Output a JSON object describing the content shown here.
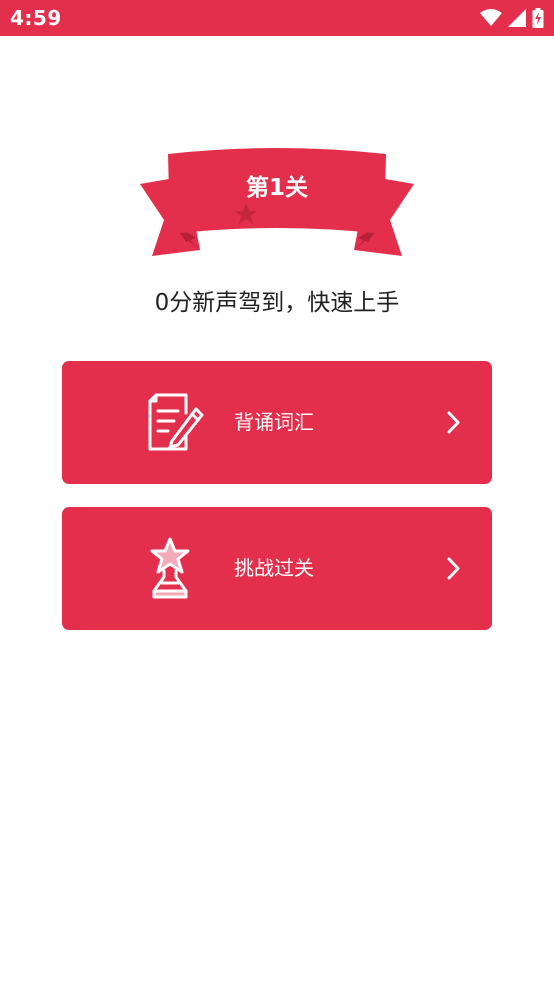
{
  "status_bar": {
    "time": "4:59",
    "icons": [
      "wifi-icon",
      "signal-icon",
      "battery-charging-icon"
    ],
    "background": "#e32f4c"
  },
  "banner": {
    "title": "第1关",
    "stars_total": 3,
    "stars_earned": 0,
    "ribbon_color": "#e32f4c",
    "ribbon_dark_color": "#b81f38",
    "star_color": "#c42640"
  },
  "subtitle": "0分新声驾到，快速上手",
  "actions": [
    {
      "label": "背诵词汇",
      "icon": "document-pen-icon",
      "arrow": "chevron-right-icon"
    },
    {
      "label": "挑战过关",
      "icon": "trophy-star-icon",
      "arrow": "chevron-right-icon"
    }
  ],
  "colors": {
    "accent": "#e32f4c",
    "text_primary": "#222222",
    "background": "#ffffff"
  }
}
